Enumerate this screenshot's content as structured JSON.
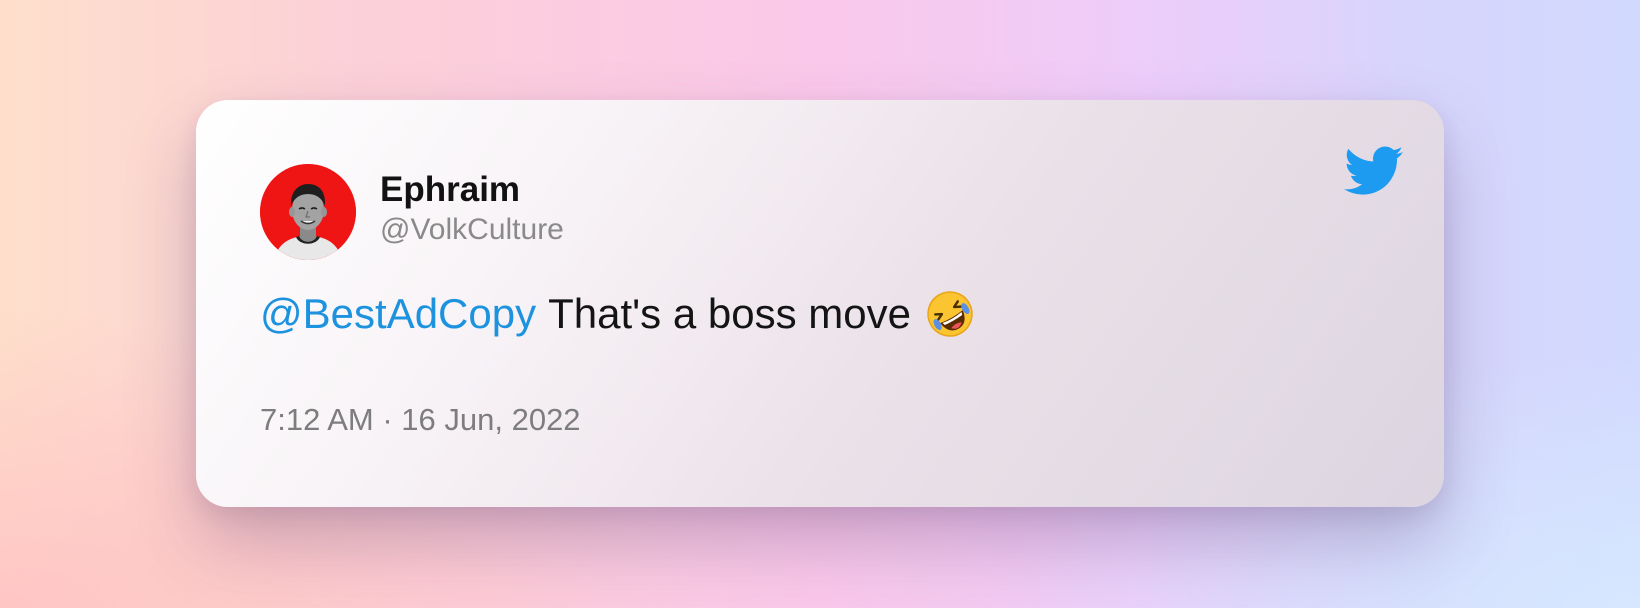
{
  "tweet": {
    "author": {
      "display_name": "Ephraim",
      "handle": "@VolkCulture",
      "avatar_bg": "#f01515"
    },
    "mention": "@BestAdCopy",
    "text": "That's a boss move",
    "emoji": "rolling-on-the-floor-laughing-emoji",
    "timestamp": "7:12 AM · 16 Jun, 2022"
  },
  "brand": {
    "logo": "twitter-bird-icon",
    "accent": "#1d9bf0",
    "mention_color": "#1d93df"
  }
}
